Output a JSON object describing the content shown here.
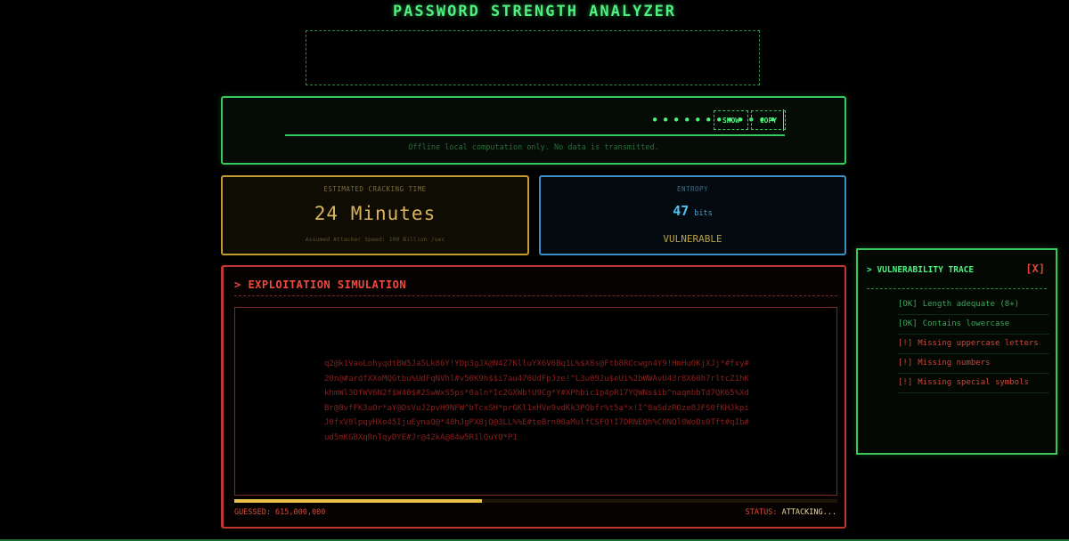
{
  "app": {
    "title": "PASSWORD STRENGTH ANALYZER"
  },
  "input": {
    "masked_value": "••••••••••••",
    "show_label": "SHOW",
    "copy_label": "COPY",
    "note": "Offline local computation only. No data is transmitted."
  },
  "cracking": {
    "label": "ESTIMATED CRACKING TIME",
    "value": "24 Minutes",
    "note": "Assumed Attacker Speed: 100 Billion /sec"
  },
  "entropy": {
    "label": "ENTROPY",
    "value": "47",
    "unit": "bits",
    "verdict": "VULNERABLE"
  },
  "simulation": {
    "title": "> EXPLOITATION SIMULATION",
    "stream": "q2@k1VaoLohyqdtBW5Ja5Lk86Y!YDp3gJX@N4Z7KlluYX6V6Bq1L%$X8s@Ftb8RCcwgn4Y9!HmHuOKjXJj*#fxy#20n@#ardfXXoMQGtbu%UdFqNVhl#v50K9h$$i7au470UdFpJze!^L3u092u$eUi%2bWWAvU43r8X60h7rltcZ1hKkhmWl3OfWV6N2f$W40$#2SwWxS5ps*0aln*Ic2GXWb!U9Cg*Y#XPhbic1p4pR17YQWNs$ib^naqmbbTd7QK65%XdBr@8vfFK3uOr*aY@DsVuJ2pvH9NFW^bTcxSH*prGKl1xHVe9vdKk3PQbfr%t5a*x!I^8aSdzROze8JFS0fKHJkpiJ0fxV8lpqyHXo45IjuEynaQ@*48hJgPX8jQ@3LL%%E#teBrn08aMulfCSFQ!I7DRNEQh%C0NQl0WoDs0Tft#qIb#ud5mKGBXqRnTqyDYE#Jr@42kA@84w5R1lQuYQ*P1",
    "progress_fraction": 0.41,
    "guessed_label": "GUESSED: 615,000,000",
    "status_label": "STATUS:",
    "status_value": "ATTACKING..."
  },
  "trace": {
    "title": "> VULNERABILITY TRACE",
    "close_label": "[X]",
    "items": [
      {
        "tag": "[OK]",
        "text": "Length adequate (8+)",
        "state": "ok"
      },
      {
        "tag": "[OK]",
        "text": "Contains lowercase",
        "state": "ok"
      },
      {
        "tag": "[!]",
        "text": "Missing uppercase letters",
        "state": "warn"
      },
      {
        "tag": "[!]",
        "text": "Missing numbers",
        "state": "warn"
      },
      {
        "tag": "[!]",
        "text": "Missing special symbols",
        "state": "warn"
      }
    ]
  },
  "colors": {
    "primary_green": "#4ef07f",
    "warning_amber": "#c49a2e",
    "info_blue": "#3b8fc4",
    "danger_red": "#c0352e"
  }
}
